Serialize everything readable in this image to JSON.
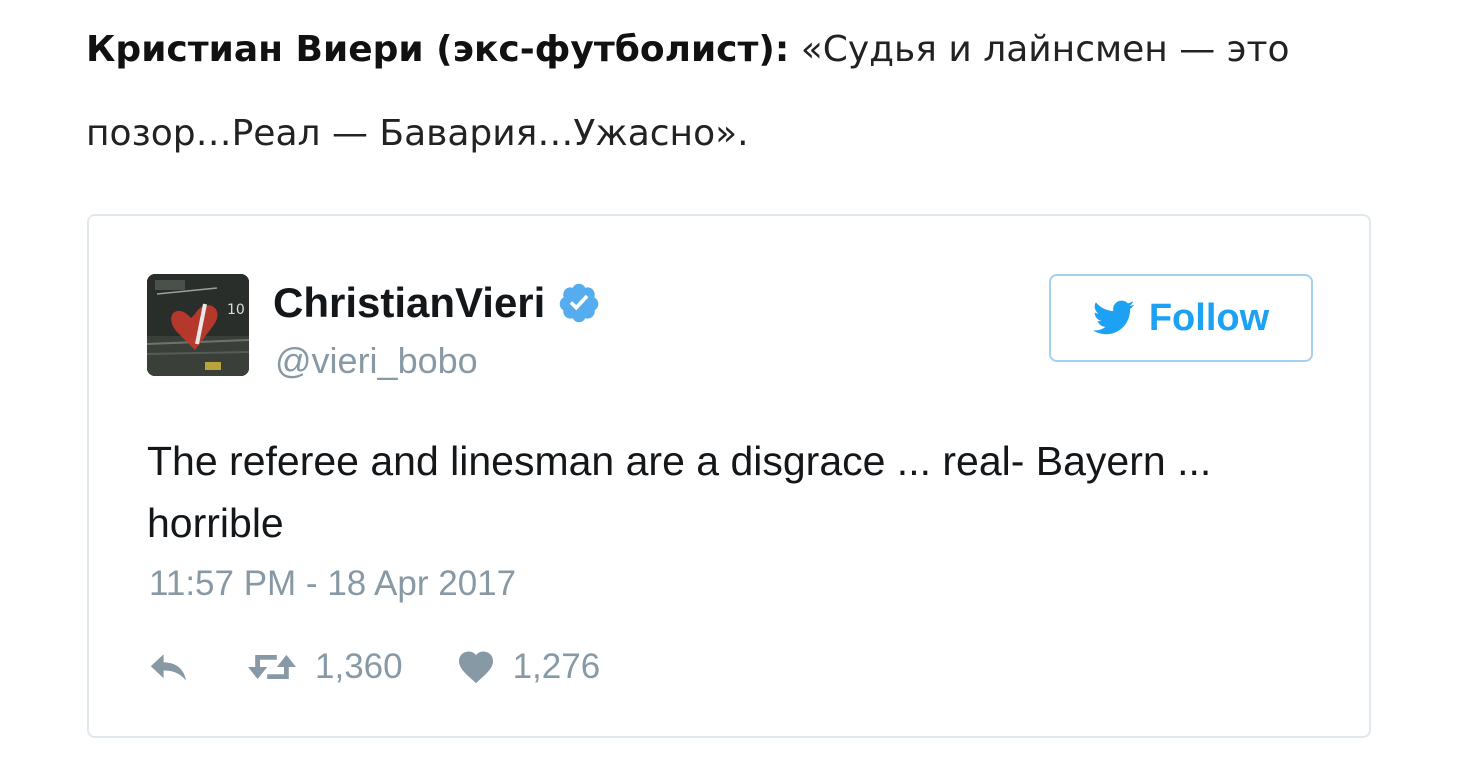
{
  "article": {
    "author_label": "Кристиан Виери (экс-футболист):",
    "quote_text": "«Судья и лайнсмен — это позор…Реал — Бавария…Ужасно»."
  },
  "tweet": {
    "display_name": "ChristianVieri",
    "handle": "@vieri_bobo",
    "verified": true,
    "follow_label": "Follow",
    "text": "The referee and linesman are a disgrace ... real- Bayern ... horrible",
    "timestamp": "11:57 PM - 18 Apr 2017",
    "retweet_count": "1,360",
    "like_count": "1,276"
  },
  "icons": {
    "verified": "verified-badge-icon",
    "follow": "twitter-bird-icon",
    "reply": "reply-icon",
    "retweet": "retweet-icon",
    "like": "heart-icon"
  },
  "colors": {
    "accent": "#1da1f2",
    "verified": "#55acee",
    "follow_border": "#a4d0f1",
    "muted": "#8899a6",
    "card_border": "#e1e8ed",
    "text": "#14171a"
  }
}
